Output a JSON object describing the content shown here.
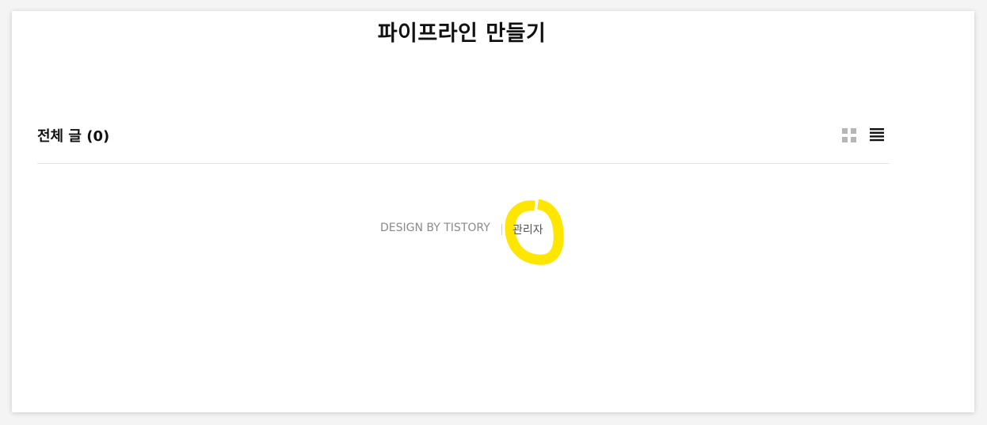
{
  "blog": {
    "title": "파이프라인 만들기"
  },
  "post_list": {
    "heading": "전체 글 (0)",
    "view_options": [
      {
        "name": "grid-view",
        "icon": "grid-icon",
        "active": false
      },
      {
        "name": "list-view",
        "icon": "list-icon",
        "active": true
      }
    ]
  },
  "footer": {
    "credit": "DESIGN BY TISTORY",
    "admin_label": "관리자"
  },
  "colors": {
    "highlight": "#ffe600",
    "text_dark": "#111111",
    "text_muted": "#8a8a8a",
    "inactive_icon": "#b5b5b5"
  }
}
